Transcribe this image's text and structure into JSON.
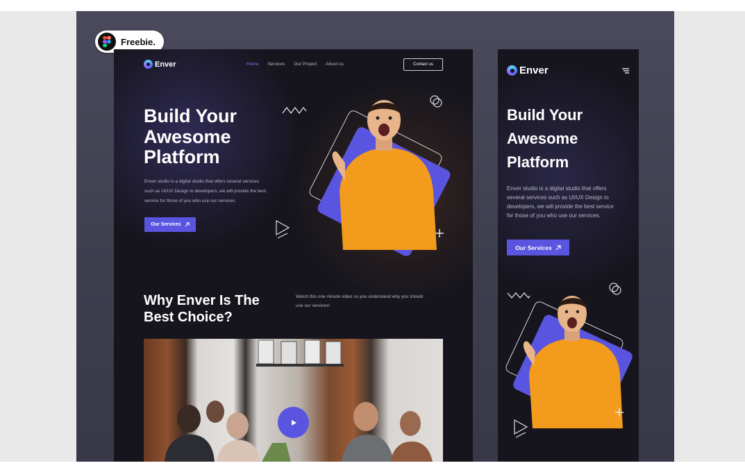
{
  "badge": {
    "label": "Freebie."
  },
  "desktop": {
    "brand": "Enver",
    "nav": [
      "Home",
      "Services",
      "Our Project",
      "About us"
    ],
    "contact_label": "Contact us",
    "hero": {
      "title_line1": "Build Your",
      "title_line2": "Awesome",
      "title_line3": "Platform",
      "desc_line1": "Enver studio is a digital studio that offers several services",
      "desc_line2": "such as UI/UX Design to developers, we will provide the best",
      "desc_line3": "service for those of you who use our services.",
      "cta": "Our Services"
    },
    "why": {
      "title_line1": "Why Enver Is The",
      "title_line2": "Best Choice?",
      "desc_line1": "Watch this one minute video so you understand why you should",
      "desc_line2": "use our services!"
    }
  },
  "mobile": {
    "brand": "Enver",
    "hero": {
      "title_line1": "Build Your",
      "title_line2": "Awesome",
      "title_line3": "Platform",
      "desc_line1": "Enver studio is a digital studio that offers",
      "desc_line2": "several services such as UI/UX Design to",
      "desc_line3": "developers, we will provide the best service",
      "desc_line4": "for those of you who use our services.",
      "cta": "Our Services"
    }
  },
  "colors": {
    "accent": "#5a55e0",
    "background": "#16151d",
    "sweater": "#f29b1c"
  },
  "icons": [
    "figma-icon",
    "arrow-up-right-icon",
    "play-icon",
    "menu-icon",
    "zigzag-icon",
    "circles-icon",
    "triangle-icon",
    "plus-icon"
  ]
}
